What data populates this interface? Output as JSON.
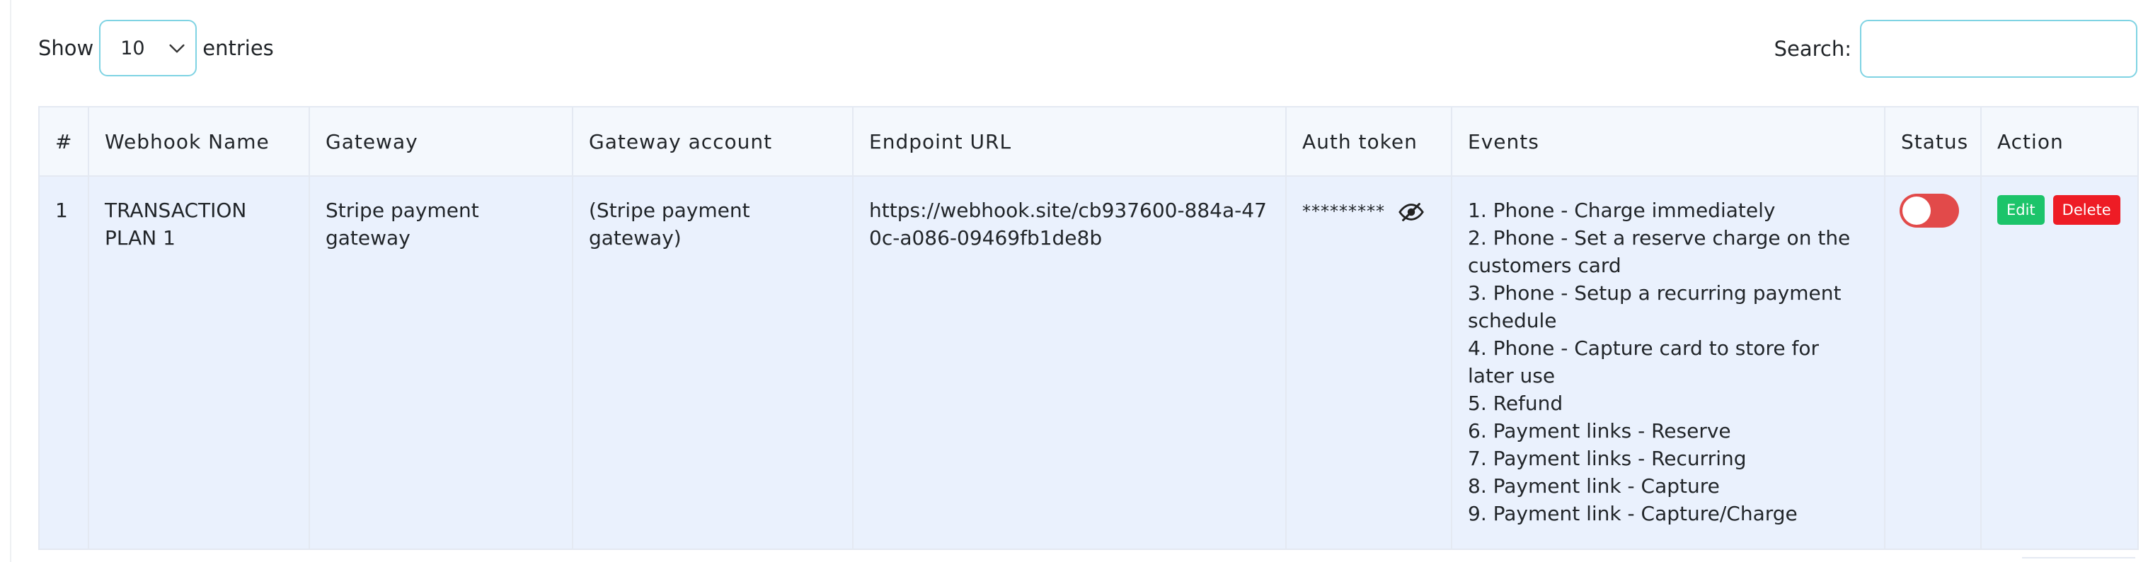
{
  "length": {
    "show_label": "Show",
    "selected": "10",
    "entries_label": "entries"
  },
  "search": {
    "label": "Search:",
    "value": ""
  },
  "table": {
    "headers": {
      "num": "#",
      "webhook_name": "Webhook Name",
      "gateway": "Gateway",
      "gateway_account": "Gateway account",
      "endpoint_url": "Endpoint URL",
      "auth_token": "Auth token",
      "events": "Events",
      "status": "Status",
      "action": "Action"
    },
    "rows": [
      {
        "num": "1",
        "webhook_name": "TRANSACTION PLAN 1",
        "gateway": "Stripe payment gateway",
        "gateway_account": "(Stripe payment gateway)",
        "endpoint_url": "https://webhook.site/cb937600-884a-470c-a086-09469fb1de8b",
        "auth_token": "*********",
        "events": [
          "1. Phone - Charge immediately",
          "2. Phone - Set a reserve charge on the customers card",
          "3. Phone - Setup a recurring payment schedule",
          "4. Phone - Capture card to store for later use",
          "5. Refund",
          "6. Payment links - Reserve",
          "7. Payment links - Recurring",
          "8. Payment link - Capture",
          "9. Payment link - Capture/Charge"
        ],
        "status_on": false,
        "edit_label": "Edit",
        "delete_label": "Delete"
      }
    ]
  },
  "icons": {
    "select_chevron": "chevron-down-icon",
    "token_visibility": "eye-slash-icon"
  },
  "colors": {
    "input_border": "#7fd3e3",
    "header_bg": "#f4f8fd",
    "row_bg": "#eaf1fd",
    "toggle_off": "#e24a4a",
    "edit": "#1cc46a",
    "delete": "#ee1c25"
  }
}
